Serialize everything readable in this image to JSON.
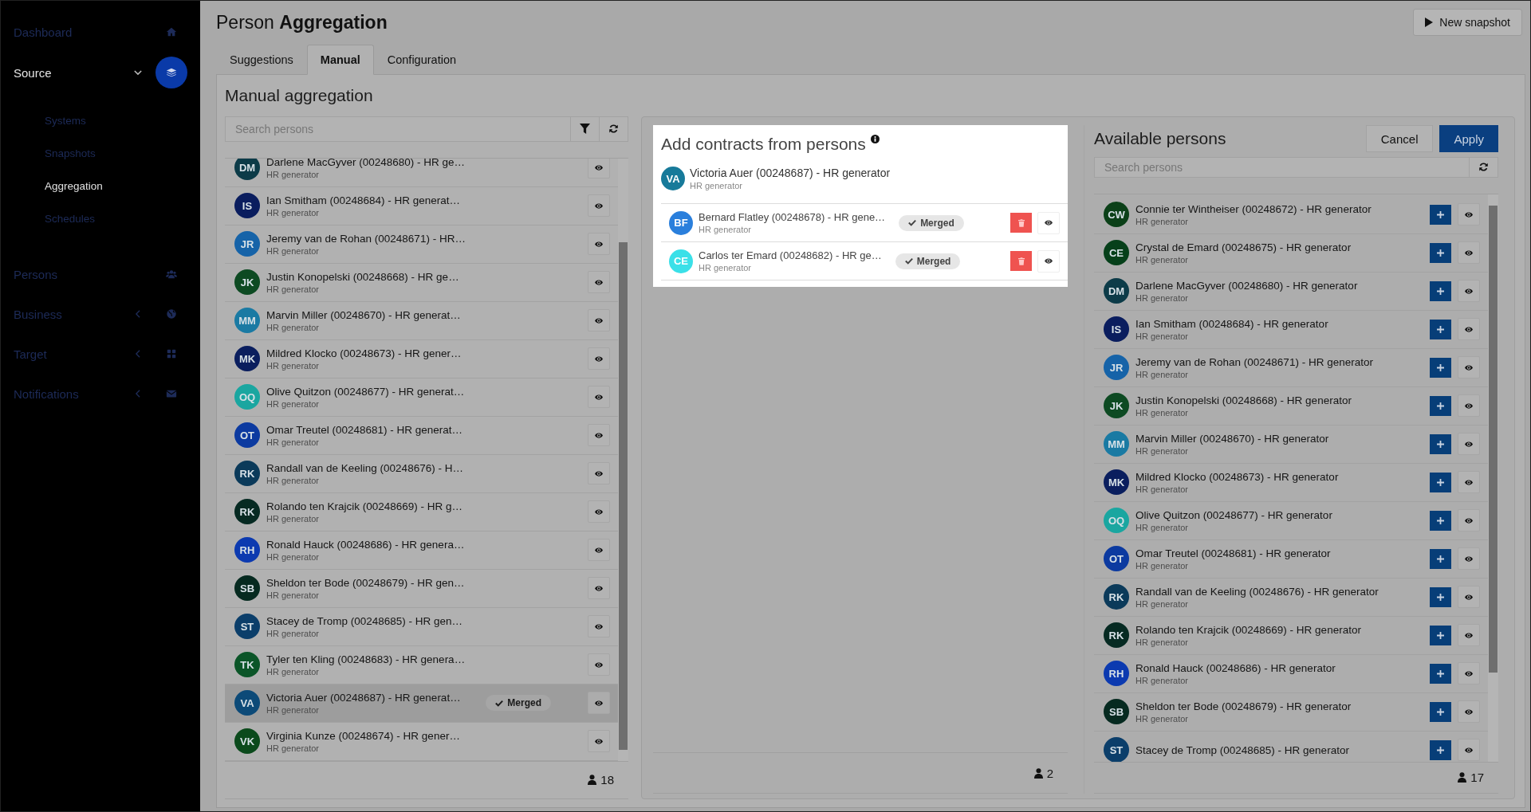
{
  "sidebar": {
    "items": [
      {
        "label": "Dashboard",
        "kind": "home",
        "selected": false
      },
      {
        "label": "Source",
        "kind": "layers",
        "selected": true,
        "expanded": true,
        "children": [
          {
            "label": "Systems",
            "selected": false
          },
          {
            "label": "Snapshots",
            "selected": false
          },
          {
            "label": "Aggregation",
            "selected": true
          },
          {
            "label": "Schedules",
            "selected": false
          }
        ]
      },
      {
        "label": "Persons",
        "kind": "people",
        "selected": false
      },
      {
        "label": "Business",
        "kind": "globe",
        "selected": false,
        "expanded": false
      },
      {
        "label": "Target",
        "kind": "grid",
        "selected": false,
        "expanded": false
      },
      {
        "label": "Notifications",
        "kind": "envelope",
        "selected": false,
        "expanded": false
      }
    ]
  },
  "page": {
    "title": "Person **Aggregation**",
    "new_snapshot_button": "New snapshot"
  },
  "tabs": [
    {
      "label": "Suggestions",
      "selected": false
    },
    {
      "label": "Manual",
      "selected": true
    },
    {
      "label": "Configuration",
      "selected": false
    }
  ],
  "manual": {
    "title": "Manual aggregation",
    "search": {
      "placeholder": "Search persons"
    },
    "count": "18",
    "persons": [
      {
        "initials": "DM",
        "color": "#0c3b48",
        "name": "Darlene MacGyver (00248680) - HR ge…",
        "sub": "HR generator",
        "selected": false
      },
      {
        "initials": "IS",
        "color": "#0a1d5e",
        "name": "Ian Smitham (00248684) - HR generat…",
        "sub": "HR generator",
        "selected": false
      },
      {
        "initials": "JR",
        "color": "#1663a8",
        "name": "Jeremy van de Rohan (00248671) - HR…",
        "sub": "HR generator",
        "selected": false
      },
      {
        "initials": "JK",
        "color": "#0d4a22",
        "name": "Justin Konopelski (00248668) - HR ge…",
        "sub": "HR generator",
        "selected": false
      },
      {
        "initials": "MM",
        "color": "#1a7aa3",
        "name": "Marvin Miller (00248670) - HR generat…",
        "sub": "HR generator",
        "selected": false
      },
      {
        "initials": "MK",
        "color": "#0a1e5e",
        "name": "Mildred Klocko (00248673) - HR gener…",
        "sub": "HR generator",
        "selected": false
      },
      {
        "initials": "OQ",
        "color": "#1aa6a0",
        "name": "Olive Quitzon (00248677) - HR generat…",
        "sub": "HR generator",
        "selected": false
      },
      {
        "initials": "OT",
        "color": "#0c3aa0",
        "name": "Omar Treutel (00248681) - HR generat…",
        "sub": "HR generator",
        "selected": false
      },
      {
        "initials": "RK",
        "color": "#0b3a5a",
        "name": "Randall van de Keeling (00248676) - H…",
        "sub": "HR generator",
        "selected": false
      },
      {
        "initials": "RK",
        "color": "#062a22",
        "name": "Rolando ten Krajcik (00248669) - HR g…",
        "sub": "HR generator",
        "selected": false
      },
      {
        "initials": "RH",
        "color": "#0c3ab0",
        "name": "Ronald Hauck (00248686) - HR genera…",
        "sub": "HR generator",
        "selected": false
      },
      {
        "initials": "SB",
        "color": "#062a20",
        "name": "Sheldon ter Bode (00248679) - HR gen…",
        "sub": "HR generator",
        "selected": false
      },
      {
        "initials": "ST",
        "color": "#0b3e6a",
        "name": "Stacey de Tromp (00248685) - HR gen…",
        "sub": "HR generator",
        "selected": false
      },
      {
        "initials": "TK",
        "color": "#0b5528",
        "name": "Tyler ten Kling (00248683) - HR genera…",
        "sub": "HR generator",
        "selected": false
      },
      {
        "initials": "VA",
        "color": "#0c4a78",
        "name": "Victoria Auer (00248687) - HR generat…",
        "sub": "HR generator",
        "selected": true,
        "badge": "Merged"
      },
      {
        "initials": "VK",
        "color": "#0b4a1c",
        "name": "Virginia Kunze (00248674) - HR gener…",
        "sub": "HR generator",
        "selected": false
      }
    ]
  },
  "contracts": {
    "title": "Add contracts from persons",
    "count": "2",
    "target": {
      "initials": "VA",
      "color": "#177a9a",
      "name": "Victoria Auer (00248687) - HR generator",
      "sub": "HR generator"
    },
    "merged": [
      {
        "initials": "BF",
        "color": "#2a7fdc",
        "name": "Bernard Flatley (00248678) - HR gene…",
        "sub": "HR generator",
        "badge": "Merged"
      },
      {
        "initials": "CE",
        "color": "#3ae0e8",
        "name": "Carlos ter Emard (00248682) - HR ge…",
        "sub": "HR generator",
        "badge": "Merged"
      }
    ]
  },
  "available": {
    "title": "Available persons",
    "cancel_button": "Cancel",
    "apply_button": "Apply",
    "search": {
      "placeholder": "Search persons"
    },
    "count": "17",
    "persons": [
      {
        "initials": "CW",
        "color": "#0b4018",
        "name": "Connie ter Wintheiser (00248672) - HR generator",
        "sub": "HR generator"
      },
      {
        "initials": "CE",
        "color": "#06401a",
        "name": "Crystal de Emard (00248675) - HR generator",
        "sub": "HR generator"
      },
      {
        "initials": "DM",
        "color": "#0c3b48",
        "name": "Darlene MacGyver (00248680) - HR generator",
        "sub": "HR generator"
      },
      {
        "initials": "IS",
        "color": "#0a1d5e",
        "name": "Ian Smitham (00248684) - HR generator",
        "sub": "HR generator"
      },
      {
        "initials": "JR",
        "color": "#1663a8",
        "name": "Jeremy van de Rohan (00248671) - HR generator",
        "sub": "HR generator"
      },
      {
        "initials": "JK",
        "color": "#0d4a22",
        "name": "Justin Konopelski (00248668) - HR generator",
        "sub": "HR generator"
      },
      {
        "initials": "MM",
        "color": "#1a7aa3",
        "name": "Marvin Miller (00248670) - HR generator",
        "sub": "HR generator"
      },
      {
        "initials": "MK",
        "color": "#0a1e5e",
        "name": "Mildred Klocko (00248673) - HR generator",
        "sub": "HR generator"
      },
      {
        "initials": "OQ",
        "color": "#1aa6a0",
        "name": "Olive Quitzon (00248677) - HR generator",
        "sub": "HR generator"
      },
      {
        "initials": "OT",
        "color": "#0c3aa0",
        "name": "Omar Treutel (00248681) - HR generator",
        "sub": "HR generator"
      },
      {
        "initials": "RK",
        "color": "#0b3a5a",
        "name": "Randall van de Keeling (00248676) - HR generator",
        "sub": "HR generator"
      },
      {
        "initials": "RK",
        "color": "#062a22",
        "name": "Rolando ten Krajcik (00248669) - HR generator",
        "sub": "HR generator"
      },
      {
        "initials": "RH",
        "color": "#0c3ab0",
        "name": "Ronald Hauck (00248686) - HR generator",
        "sub": "HR generator"
      },
      {
        "initials": "SB",
        "color": "#062a20",
        "name": "Sheldon ter Bode (00248679) - HR generator",
        "sub": "HR generator"
      },
      {
        "initials": "ST",
        "color": "#0b3e6a",
        "name": "Stacey de Tromp (00248685) - HR generator"
      }
    ]
  }
}
